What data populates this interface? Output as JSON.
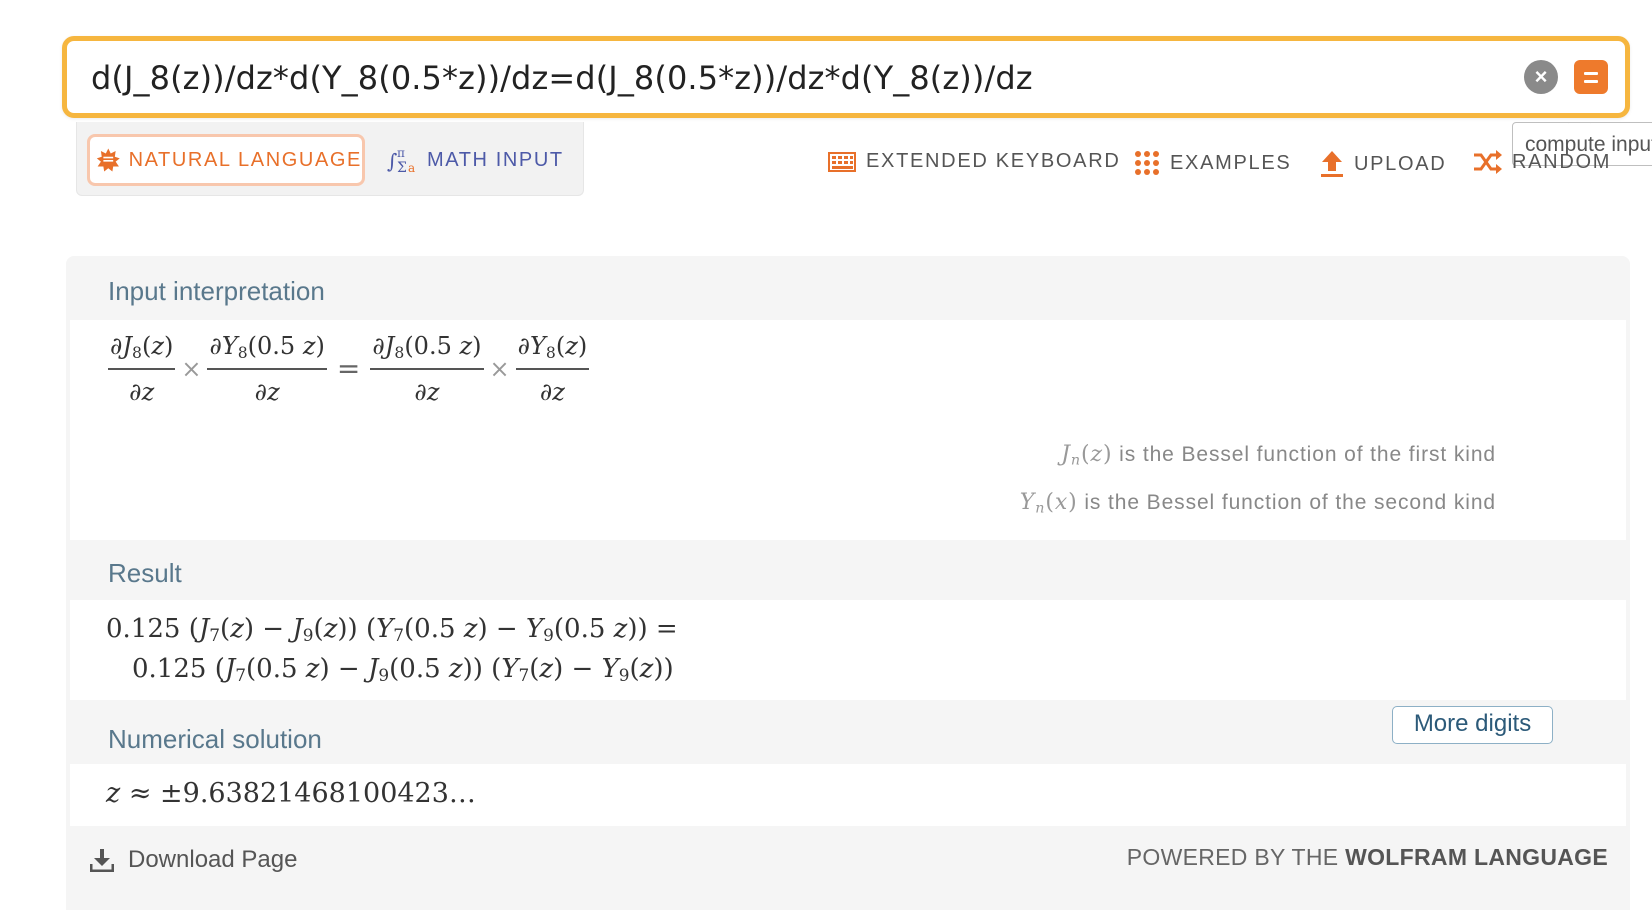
{
  "search": {
    "query": "d(J_8(z))/dz*d(Y_8(0.5*z))/dz=d(J_8(0.5*z))/dz*d(Y_8(z))/dz",
    "clear_icon": "×",
    "compute_tooltip": "compute input"
  },
  "modes": {
    "natural_language": "NATURAL LANGUAGE",
    "math_input": "MATH INPUT"
  },
  "toolbar": {
    "extended_keyboard": "EXTENDED KEYBOARD",
    "examples": "EXAMPLES",
    "upload": "UPLOAD",
    "random": "RANDOM"
  },
  "pods": {
    "input_interpretation": {
      "title": "Input interpretation",
      "expression": "∂J_8(z)/∂z × ∂Y_8(0.5 z)/∂z = ∂J_8(0.5 z)/∂z × ∂Y_8(z)/∂z",
      "note1_text": " is the Bessel function of the first kind",
      "note2_text": " is the Bessel function of the second kind"
    },
    "result": {
      "title": "Result",
      "line1": "0.125 (J_7(z) − J_9(z)) (Y_7(0.5 z) − Y_9(0.5 z)) =",
      "line2": "0.125 (J_7(0.5 z) − J_9(0.5 z)) (Y_7(z) − Y_9(z))"
    },
    "numerical_solution": {
      "title": "Numerical solution",
      "more_digits": "More digits",
      "value": "±9.63821468100423…"
    }
  },
  "footer": {
    "download": "Download Page",
    "powered_prefix": "POWERED BY THE ",
    "powered_brand": "WOLFRAM LANGUAGE"
  },
  "colors": {
    "search_border": "#f6b63f",
    "accent_orange": "#ee7a2c",
    "math_input_purple": "#4d5aa8",
    "pod_title": "#59788c"
  }
}
